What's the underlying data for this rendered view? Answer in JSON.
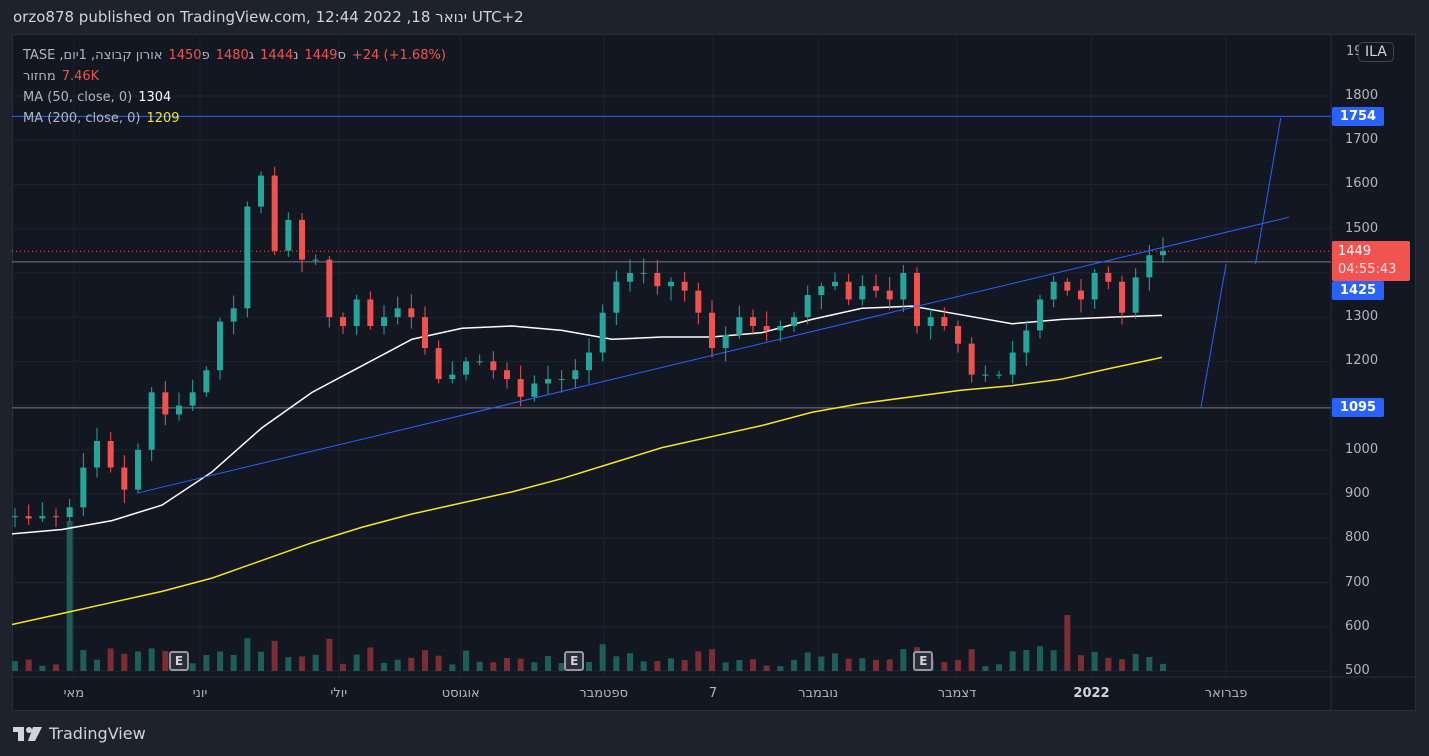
{
  "header": {
    "text": "orzo878 published on TradingView.com, 12:44 2022 ,18 ינואר UTC+2"
  },
  "legend": {
    "symbol": "אורון קבוצה, 1יום, TASE",
    "open_label": "פ",
    "open": "1450",
    "high_label": "ג",
    "high": "1480",
    "low_label": "נ",
    "low": "1444",
    "close_label": "ס",
    "close": "1449",
    "change": "+24 (+1.68%)",
    "volume_label": "מחזור",
    "volume": "7.46K",
    "ma50_label": "MA (50, close, 0)",
    "ma50": "1304",
    "ma200_label": "MA (200, close, 0)",
    "ma200": "1209"
  },
  "currency": "ILA",
  "price_axis": {
    "top_partial": "19",
    "ticks": [
      "1800",
      "1700",
      "1600",
      "1500",
      "1300",
      "1200",
      "1000",
      "900",
      "800",
      "700",
      "600",
      "500"
    ]
  },
  "badges": {
    "level_top": "1754",
    "level_mid": "1425",
    "level_low": "1095",
    "last_price": "1449",
    "countdown": "04:55:43"
  },
  "time_axis": [
    {
      "label": "מאי",
      "day": 14
    },
    {
      "label": "יוני",
      "day": 44
    },
    {
      "label": "יולי",
      "day": 77
    },
    {
      "label": "אוגוסט",
      "day": 106
    },
    {
      "label": "ספטמבר",
      "day": 140
    },
    {
      "label": "7",
      "day": 166
    },
    {
      "label": "נובמבר",
      "day": 191
    },
    {
      "label": "דצמבר",
      "day": 224
    },
    {
      "label": "2022",
      "day": 256
    },
    {
      "label": "פברואר",
      "day": 288
    }
  ],
  "earnings": [
    {
      "label": "E",
      "day": 39
    },
    {
      "label": "E",
      "day": 133
    },
    {
      "label": "E",
      "day": 216
    }
  ],
  "footer": {
    "brand": "TradingView"
  },
  "colors": {
    "up": "#26a69a",
    "down": "#ef5350",
    "ma50": "#ffffff",
    "ma200": "#f2e72b",
    "drawing": "#2962ff"
  },
  "chart_data": {
    "type": "candlestick",
    "symbol": "אורון קבוצה, TASE, 1D",
    "ylim": [
      480,
      1920
    ],
    "xlim_days": [
      0,
      318
    ],
    "closes": [
      850,
      845,
      850,
      848,
      870,
      960,
      1020,
      960,
      910,
      1000,
      1130,
      1080,
      1100,
      1130,
      1180,
      1290,
      1320,
      1550,
      1620,
      1450,
      1520,
      1430,
      1430,
      1300,
      1280,
      1340,
      1280,
      1300,
      1320,
      1300,
      1230,
      1160,
      1170,
      1200,
      1200,
      1180,
      1160,
      1120,
      1150,
      1160,
      1160,
      1180,
      1220,
      1310,
      1380,
      1400,
      1400,
      1370,
      1380,
      1360,
      1310,
      1230,
      1260,
      1300,
      1280,
      1270,
      1280,
      1300,
      1350,
      1370,
      1380,
      1340,
      1370,
      1360,
      1340,
      1400,
      1280,
      1300,
      1280,
      1240,
      1170,
      1170,
      1170,
      1220,
      1270,
      1340,
      1380,
      1360,
      1340,
      1400,
      1380,
      1310,
      1390,
      1440,
      1449
    ],
    "ma50": [
      810,
      820,
      840,
      875,
      950,
      1050,
      1130,
      1190,
      1250,
      1275,
      1280,
      1270,
      1250,
      1255,
      1255,
      1265,
      1295,
      1320,
      1325,
      1305,
      1285,
      1295,
      1300,
      1304
    ],
    "ma200": [
      605,
      630,
      655,
      680,
      710,
      750,
      790,
      825,
      855,
      880,
      905,
      935,
      970,
      1005,
      1030,
      1055,
      1085,
      1105,
      1120,
      1135,
      1145,
      1160,
      1185,
      1209
    ],
    "horizontal_levels": [
      1754,
      1425,
      1095
    ],
    "last_price": 1449,
    "trendlines": [
      {
        "from": [
          29,
          902
        ],
        "to": [
          303,
          1526
        ]
      },
      {
        "from": [
          282,
          1095
        ],
        "to": [
          288,
          1420
        ]
      },
      {
        "from": [
          295,
          1420
        ],
        "to": [
          301,
          1750
        ]
      }
    ]
  }
}
